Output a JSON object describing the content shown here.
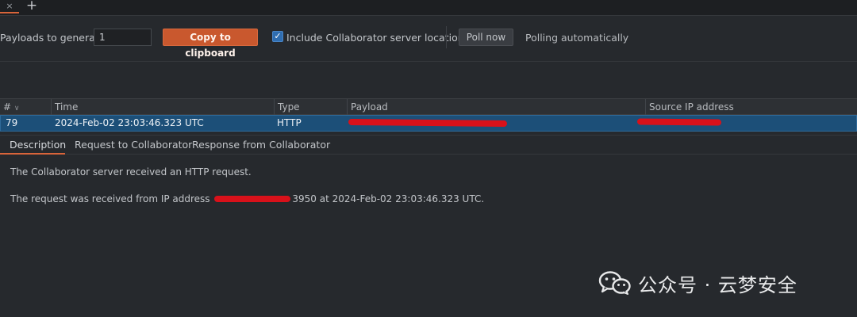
{
  "tabs": {
    "close_glyph": "×",
    "add_glyph": "+"
  },
  "toolbar": {
    "payloads_label": "Payloads to generate:",
    "payloads_value": "1",
    "copy_button": "Copy to clipboard",
    "include_location_label": "Include Collaborator server location",
    "include_location_checked": true,
    "poll_button": "Poll now",
    "polling_status": "Polling automatically"
  },
  "table": {
    "columns": [
      "#",
      "Time",
      "Type",
      "Payload",
      "Source IP address"
    ],
    "sort_glyph": "∨",
    "rows": [
      {
        "number": "79",
        "time": "2024-Feb-02 23:03:46.323 UTC",
        "type": "HTTP",
        "payload": "",
        "source_ip": ""
      }
    ]
  },
  "detail_tabs": [
    "Description",
    "Request to Collaborator",
    "Response from Collaborator"
  ],
  "description": {
    "line1": "The Collaborator server received an HTTP request.",
    "line2_prefix": "The request was received from IP address ",
    "line2_suffix": "3950 at 2024-Feb-02 23:03:46.323 UTC."
  },
  "watermark": {
    "text": "公众号 · 云梦安全"
  },
  "colors": {
    "accent": "#d8643a",
    "selection": "#1c4f78",
    "redaction": "#d8111a",
    "checkbox": "#2f6db0"
  }
}
